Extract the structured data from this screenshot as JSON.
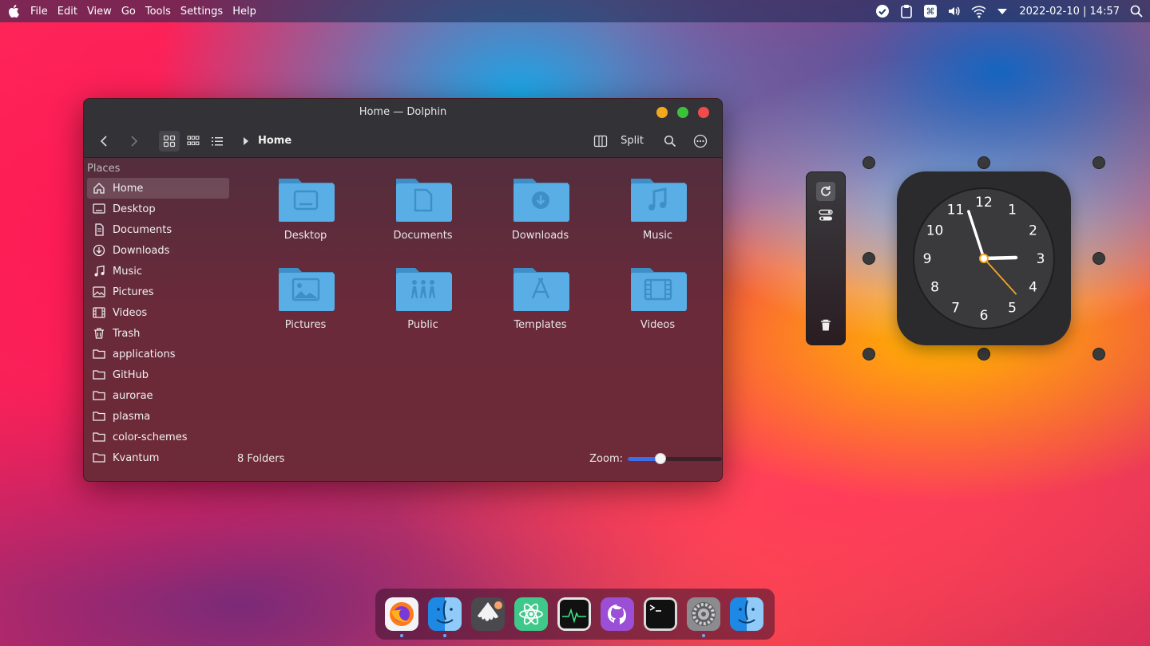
{
  "menubar": {
    "menus": [
      "File",
      "Edit",
      "View",
      "Go",
      "Tools",
      "Settings",
      "Help"
    ],
    "datetime": "2022-02-10 | 14:57"
  },
  "window": {
    "title": "Home — Dolphin",
    "breadcrumb": "Home",
    "split_label": "Split",
    "places_title": "Places",
    "places": [
      "Home",
      "Desktop",
      "Documents",
      "Downloads",
      "Music",
      "Pictures",
      "Videos",
      "Trash",
      "applications",
      "GitHub",
      "aurorae",
      "plasma",
      "color-schemes",
      "Kvantum"
    ],
    "folders": [
      "Desktop",
      "Documents",
      "Downloads",
      "Music",
      "Pictures",
      "Public",
      "Templates",
      "Videos"
    ],
    "status": "8 Folders",
    "zoom_label": "Zoom:",
    "zoom_level": 0.35
  },
  "clock": {
    "numbers": [
      "12",
      "1",
      "2",
      "3",
      "4",
      "5",
      "6",
      "7",
      "8",
      "9",
      "10",
      "11"
    ],
    "time": "14:57"
  },
  "colors": {
    "folder": "#5aaee6",
    "folder_dark": "#3e8fc8",
    "accent": "#3d6ee8",
    "second_hand": "#f5a623"
  },
  "dock": [
    "firefox",
    "finder",
    "inkscape",
    "atom",
    "system-monitor",
    "github-desktop",
    "terminal",
    "system-preferences",
    "finder"
  ]
}
